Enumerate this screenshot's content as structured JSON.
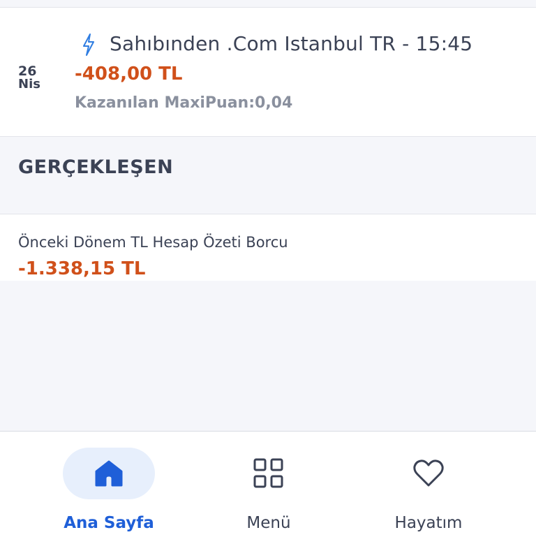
{
  "transaction": {
    "day": "26",
    "month": "Nis",
    "merchant": "Sahıbınden .Com Istanbul TR - 15:45",
    "amount": "-408,00 TL",
    "points": "Kazanılan MaxiPuan:0,04",
    "icon": "lightning-icon"
  },
  "section": {
    "title": "GERÇEKLEŞEN"
  },
  "statement": {
    "label": "Önceki Dönem TL Hesap Özeti Borcu",
    "amount": "-1.338,15 TL"
  },
  "bottom_nav": {
    "items": [
      {
        "label": "Ana Sayfa",
        "icon": "home-icon",
        "active": true
      },
      {
        "label": "Menü",
        "icon": "grid-icon",
        "active": false
      },
      {
        "label": "Hayatım",
        "icon": "heart-icon",
        "active": false
      }
    ]
  },
  "colors": {
    "accent": "#1f5fd8",
    "negative_amount": "#d0501a",
    "text": "#3b4255",
    "muted": "#8a909e"
  }
}
